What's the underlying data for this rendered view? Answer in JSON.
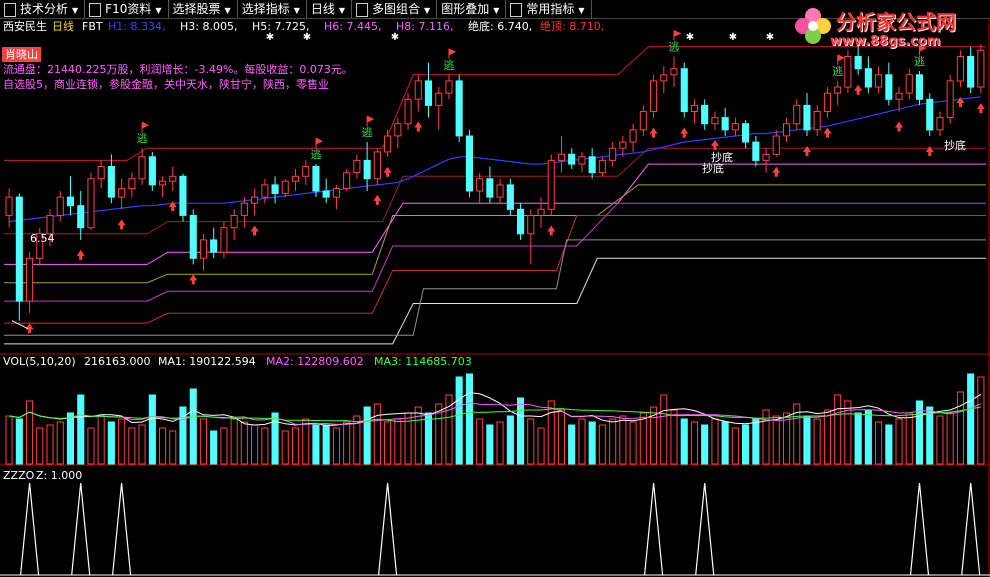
{
  "toolbar": {
    "items": [
      {
        "label": "技术分析",
        "icon": "grid-icon"
      },
      {
        "label": "F10资料",
        "icon": "grid-icon"
      },
      {
        "label": "选择股票",
        "icon": ""
      },
      {
        "label": "选择指标",
        "icon": ""
      },
      {
        "label": "日线",
        "icon": ""
      },
      {
        "label": "多图组合",
        "icon": "grid-icon"
      },
      {
        "label": "图形叠加",
        "icon": ""
      },
      {
        "label": "常用指标",
        "icon": "lock-icon"
      }
    ]
  },
  "stock": {
    "name": "西安民生",
    "period": "日线",
    "indicator": "FBT",
    "params": [
      {
        "label": "H1: 8.334,",
        "color": "#4040ff"
      },
      {
        "label": "H3: 8.005,",
        "color": "#ffffff"
      },
      {
        "label": "H5: 7.725,",
        "color": "#ffffff"
      },
      {
        "label": "H6: 7.445,",
        "color": "#ff60ff"
      },
      {
        "label": "H8: 7.116,",
        "color": "#ff60ff"
      },
      {
        "label": "绝底: 6.740,",
        "color": "#ffffff"
      },
      {
        "label": "绝顶: 8.710,",
        "color": "#ff3030"
      }
    ]
  },
  "info": {
    "tag": "肖晓山",
    "line1": "流通盘：21440.225万股，利润增长：-3.49%。每股收益：0.073元。",
    "line2": "自选股5，商业连锁，参股金融，关中天水，陕甘宁，陕西，零售业"
  },
  "annotations": {
    "low_price": "6.54",
    "escape": "逃",
    "bottom1": "抄底",
    "bottom2": "抄底",
    "bottom3": "抄底"
  },
  "vol": {
    "title": "VOL(5,10,20)",
    "value": "216163.000",
    "ma1_label": "MA1: 190122.594",
    "ma2_label": "MA2: 122809.602",
    "ma3_label": "MA3: 114685.703"
  },
  "zzzo": {
    "title": "ZZZO",
    "z_label": "Z: 1.000"
  },
  "logo": {
    "title": "分析家公式网",
    "url": "www.88gs.com"
  },
  "colors": {
    "up": "#ff4040",
    "down": "#50ffff",
    "ma_blue": "#3040ff",
    "mid": "#ff60ff",
    "red_band": "#c82020",
    "olive_band": "#b0a030",
    "white_band": "#e0e0e0"
  },
  "chart_data": {
    "type": "candlestick",
    "n": 96,
    "price_range": [
      6.3,
      8.9
    ],
    "ohlc": [
      [
        7.4,
        7.62,
        7.3,
        7.55
      ],
      [
        7.55,
        7.58,
        6.54,
        6.7
      ],
      [
        6.7,
        7.1,
        6.6,
        7.05
      ],
      [
        7.05,
        7.3,
        7.0,
        7.25
      ],
      [
        7.25,
        7.45,
        7.15,
        7.4
      ],
      [
        7.4,
        7.6,
        7.35,
        7.55
      ],
      [
        7.55,
        7.72,
        7.4,
        7.48
      ],
      [
        7.48,
        7.6,
        7.2,
        7.3
      ],
      [
        7.3,
        7.75,
        7.28,
        7.7
      ],
      [
        7.7,
        7.85,
        7.62,
        7.8
      ],
      [
        7.8,
        7.9,
        7.5,
        7.55
      ],
      [
        7.55,
        7.7,
        7.45,
        7.62
      ],
      [
        7.62,
        7.75,
        7.55,
        7.7
      ],
      [
        7.7,
        7.95,
        7.65,
        7.88
      ],
      [
        7.88,
        7.92,
        7.6,
        7.65
      ],
      [
        7.65,
        7.72,
        7.55,
        7.68
      ],
      [
        7.68,
        7.8,
        7.6,
        7.72
      ],
      [
        7.72,
        7.74,
        7.35,
        7.4
      ],
      [
        7.4,
        7.45,
        7.0,
        7.05
      ],
      [
        7.05,
        7.25,
        6.95,
        7.2
      ],
      [
        7.2,
        7.3,
        7.05,
        7.1
      ],
      [
        7.1,
        7.35,
        7.05,
        7.3
      ],
      [
        7.3,
        7.45,
        7.2,
        7.4
      ],
      [
        7.4,
        7.55,
        7.3,
        7.5
      ],
      [
        7.5,
        7.62,
        7.4,
        7.55
      ],
      [
        7.55,
        7.7,
        7.5,
        7.65
      ],
      [
        7.65,
        7.72,
        7.5,
        7.58
      ],
      [
        7.58,
        7.7,
        7.55,
        7.68
      ],
      [
        7.68,
        7.78,
        7.6,
        7.72
      ],
      [
        7.72,
        7.85,
        7.65,
        7.8
      ],
      [
        7.8,
        7.82,
        7.55,
        7.6
      ],
      [
        7.6,
        7.7,
        7.5,
        7.55
      ],
      [
        7.55,
        7.65,
        7.45,
        7.62
      ],
      [
        7.62,
        7.78,
        7.6,
        7.75
      ],
      [
        7.75,
        7.9,
        7.7,
        7.85
      ],
      [
        7.85,
        8.0,
        7.6,
        7.7
      ],
      [
        7.7,
        7.95,
        7.65,
        7.92
      ],
      [
        7.92,
        8.1,
        7.88,
        8.05
      ],
      [
        8.05,
        8.2,
        7.95,
        8.15
      ],
      [
        8.15,
        8.4,
        8.1,
        8.35
      ],
      [
        8.35,
        8.55,
        8.25,
        8.5
      ],
      [
        8.5,
        8.65,
        8.2,
        8.3
      ],
      [
        8.3,
        8.45,
        8.1,
        8.4
      ],
      [
        8.4,
        8.55,
        8.35,
        8.5
      ],
      [
        8.5,
        8.55,
        8.0,
        8.05
      ],
      [
        8.05,
        8.1,
        7.55,
        7.6
      ],
      [
        7.6,
        7.75,
        7.5,
        7.7
      ],
      [
        7.7,
        7.8,
        7.5,
        7.55
      ],
      [
        7.55,
        7.7,
        7.5,
        7.65
      ],
      [
        7.65,
        7.7,
        7.4,
        7.45
      ],
      [
        7.45,
        7.5,
        7.2,
        7.25
      ],
      [
        7.25,
        7.45,
        7.0,
        7.4
      ],
      [
        7.4,
        7.55,
        7.3,
        7.45
      ],
      [
        7.45,
        7.9,
        7.4,
        7.85
      ],
      [
        7.85,
        8.05,
        7.75,
        7.9
      ],
      [
        7.9,
        7.95,
        7.78,
        7.82
      ],
      [
        7.82,
        7.92,
        7.75,
        7.88
      ],
      [
        7.88,
        7.95,
        7.7,
        7.75
      ],
      [
        7.75,
        7.88,
        7.72,
        7.85
      ],
      [
        7.85,
        8.0,
        7.8,
        7.95
      ],
      [
        7.95,
        8.05,
        7.88,
        8.0
      ],
      [
        8.0,
        8.15,
        7.92,
        8.1
      ],
      [
        8.1,
        8.3,
        8.05,
        8.25
      ],
      [
        8.25,
        8.55,
        8.2,
        8.5
      ],
      [
        8.5,
        8.62,
        8.4,
        8.55
      ],
      [
        8.55,
        8.7,
        8.45,
        8.6
      ],
      [
        8.6,
        8.65,
        8.2,
        8.25
      ],
      [
        8.25,
        8.35,
        8.15,
        8.3
      ],
      [
        8.3,
        8.35,
        8.1,
        8.15
      ],
      [
        8.15,
        8.25,
        8.1,
        8.2
      ],
      [
        8.2,
        8.28,
        8.05,
        8.1
      ],
      [
        8.1,
        8.2,
        8.05,
        8.15
      ],
      [
        8.15,
        8.18,
        7.95,
        8.0
      ],
      [
        8.0,
        8.05,
        7.8,
        7.85
      ],
      [
        7.85,
        7.95,
        7.75,
        7.9
      ],
      [
        7.9,
        8.1,
        7.88,
        8.05
      ],
      [
        8.05,
        8.2,
        8.0,
        8.15
      ],
      [
        8.15,
        8.35,
        8.1,
        8.3
      ],
      [
        8.3,
        8.4,
        8.05,
        8.1
      ],
      [
        8.1,
        8.3,
        8.05,
        8.25
      ],
      [
        8.25,
        8.45,
        8.2,
        8.4
      ],
      [
        8.4,
        8.5,
        8.3,
        8.45
      ],
      [
        8.45,
        8.75,
        8.4,
        8.7
      ],
      [
        8.7,
        8.8,
        8.55,
        8.6
      ],
      [
        8.6,
        8.7,
        8.4,
        8.45
      ],
      [
        8.45,
        8.62,
        8.4,
        8.55
      ],
      [
        8.55,
        8.65,
        8.3,
        8.35
      ],
      [
        8.35,
        8.45,
        8.25,
        8.4
      ],
      [
        8.4,
        8.6,
        8.35,
        8.55
      ],
      [
        8.55,
        8.58,
        8.3,
        8.35
      ],
      [
        8.35,
        8.4,
        8.05,
        8.1
      ],
      [
        8.1,
        8.25,
        8.05,
        8.2
      ],
      [
        8.2,
        8.55,
        8.15,
        8.5
      ],
      [
        8.5,
        8.75,
        8.45,
        8.7
      ],
      [
        8.7,
        8.78,
        8.4,
        8.45
      ],
      [
        8.45,
        8.8,
        8.4,
        8.75
      ]
    ],
    "volume": [
      160,
      150,
      210,
      120,
      130,
      140,
      170,
      230,
      120,
      160,
      140,
      150,
      120,
      130,
      230,
      120,
      110,
      190,
      250,
      150,
      110,
      120,
      150,
      140,
      130,
      120,
      170,
      110,
      120,
      150,
      130,
      130,
      120,
      140,
      160,
      190,
      200,
      140,
      150,
      170,
      190,
      170,
      200,
      230,
      290,
      300,
      150,
      130,
      140,
      160,
      220,
      150,
      120,
      210,
      180,
      130,
      150,
      140,
      130,
      150,
      160,
      140,
      170,
      190,
      230,
      180,
      150,
      140,
      130,
      150,
      140,
      120,
      130,
      150,
      180,
      160,
      170,
      200,
      160,
      150,
      180,
      230,
      210,
      170,
      180,
      140,
      130,
      150,
      170,
      210,
      190,
      160,
      170,
      240,
      300,
      290
    ],
    "ma_blue": [
      7.35,
      7.36,
      7.37,
      7.38,
      7.39,
      7.4,
      7.41,
      7.42,
      7.43,
      7.44,
      7.45,
      7.46,
      7.47,
      7.48,
      7.48,
      7.49,
      7.5,
      7.5,
      7.5,
      7.5,
      7.5,
      7.5,
      7.51,
      7.52,
      7.53,
      7.54,
      7.55,
      7.56,
      7.57,
      7.58,
      7.59,
      7.6,
      7.61,
      7.62,
      7.63,
      7.64,
      7.65,
      7.66,
      7.67,
      7.7,
      7.74,
      7.78,
      7.82,
      7.86,
      7.88,
      7.88,
      7.87,
      7.86,
      7.85,
      7.84,
      7.83,
      7.82,
      7.82,
      7.83,
      7.84,
      7.85,
      7.86,
      7.87,
      7.88,
      7.89,
      7.9,
      7.91,
      7.92,
      7.94,
      7.96,
      7.98,
      8.0,
      8.01,
      8.02,
      8.03,
      8.04,
      8.05,
      8.06,
      8.07,
      8.07,
      8.08,
      8.09,
      8.1,
      8.11,
      8.12,
      8.13,
      8.15,
      8.17,
      8.19,
      8.21,
      8.23,
      8.25,
      8.27,
      8.29,
      8.31,
      8.32,
      8.33,
      8.34,
      8.35,
      8.36,
      8.37
    ],
    "zzzo_peaks": [
      2,
      7,
      11,
      37,
      63,
      68,
      89,
      94
    ]
  }
}
